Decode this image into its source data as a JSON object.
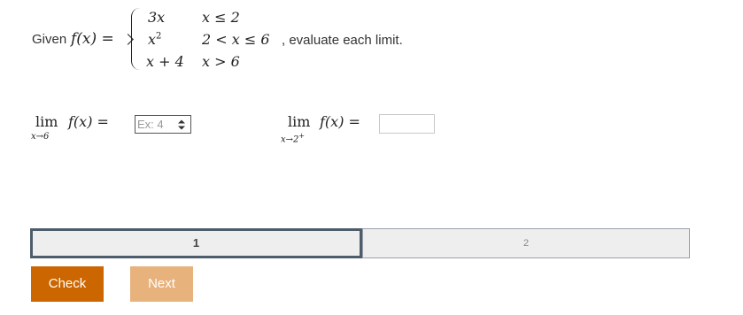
{
  "problem": {
    "given_label": "Given",
    "function": "f(x) =",
    "cases": [
      {
        "expr": "3x",
        "cond": "x ≤ 2"
      },
      {
        "expr": "x",
        "expr_sup": "2",
        "cond": "2 < x ≤ 6"
      },
      {
        "expr": "x + 4",
        "cond": "x > 6"
      }
    ],
    "tail": ", evaluate each limit."
  },
  "limits": [
    {
      "lim": "lim",
      "sub": "x→6",
      "fn": "f(x) =",
      "input_placeholder": "Ex: 4",
      "input_value": ""
    },
    {
      "lim": "lim",
      "sub": "x→2",
      "sub_sup": "+",
      "fn": "f(x) =",
      "input_value": ""
    }
  ],
  "progress": {
    "tabs": [
      {
        "label": "1",
        "active": true
      },
      {
        "label": "2",
        "active": false
      }
    ]
  },
  "buttons": {
    "check": "Check",
    "next": "Next"
  },
  "colors": {
    "check": "#cc6600",
    "next": "#e8b27c",
    "active_tab_border": "#4e5d6c",
    "tab_bg": "#eeeeee"
  }
}
